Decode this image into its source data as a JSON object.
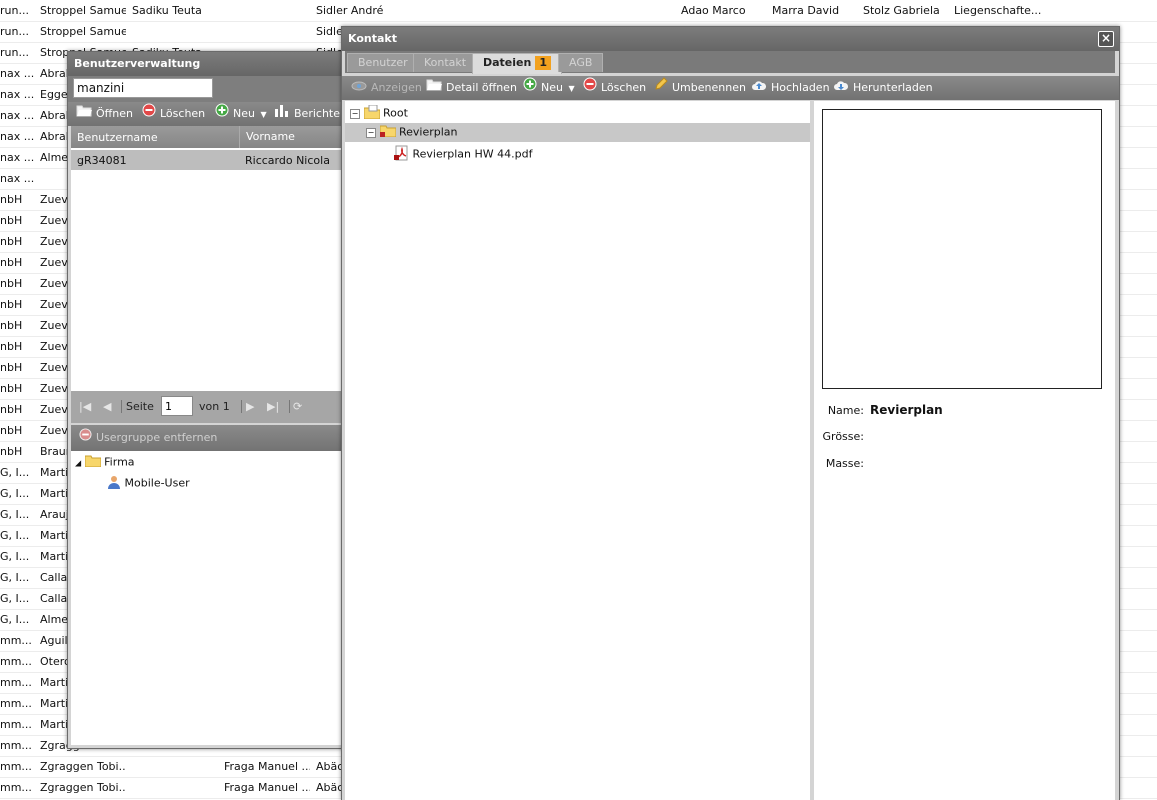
{
  "background_grid": {
    "rows": [
      {
        "c0": "run...",
        "c1": "Stroppel Samuel",
        "c2": "Sadiku Teuta",
        "c3": "",
        "c4": "Sidler André",
        "c5": "Adao Marco",
        "c6": "Marra David",
        "c7": "Stolz Gabriela",
        "c8": "Liegenschafte..."
      },
      {
        "c0": "run...",
        "c1": "Stroppel Samuel",
        "c2": "",
        "c3": "",
        "c4": "Sidle",
        "c5": "",
        "c6": "",
        "c7": "",
        "c8": ""
      },
      {
        "c0": "run...",
        "c1": "Stroppel Samuel",
        "c2": "Sadiku Teuta",
        "c3": "",
        "c4": "Sidle",
        "c5": "",
        "c6": "",
        "c7": "",
        "c8": ""
      },
      {
        "c0": "nax ...",
        "c1": "Abrah",
        "c2": "",
        "c3": "",
        "c4": "",
        "c5": "",
        "c6": "",
        "c7": "",
        "c8": ""
      },
      {
        "c0": "nax ...",
        "c1": "Egger",
        "c2": "",
        "c3": "",
        "c4": "",
        "c5": "",
        "c6": "",
        "c7": "",
        "c8": ""
      },
      {
        "c0": "nax ...",
        "c1": "Abrah",
        "c2": "",
        "c3": "",
        "c4": "",
        "c5": "",
        "c6": "",
        "c7": "",
        "c8": ""
      },
      {
        "c0": "nax ...",
        "c1": "Abrah",
        "c2": "",
        "c3": "",
        "c4": "",
        "c5": "",
        "c6": "",
        "c7": "",
        "c8": ""
      },
      {
        "c0": "nax ...",
        "c1": "Almei",
        "c2": "",
        "c3": "",
        "c4": "",
        "c5": "",
        "c6": "",
        "c7": "",
        "c8": ""
      },
      {
        "c0": "nax ...",
        "c1": "",
        "c2": "",
        "c3": "",
        "c4": "",
        "c5": "",
        "c6": "",
        "c7": "",
        "c8": ""
      },
      {
        "c0": "nbH",
        "c1": "Zuev",
        "c2": "",
        "c3": "",
        "c4": "",
        "c5": "",
        "c6": "",
        "c7": "",
        "c8": ""
      },
      {
        "c0": "nbH",
        "c1": "Zuev",
        "c2": "",
        "c3": "",
        "c4": "",
        "c5": "",
        "c6": "",
        "c7": "",
        "c8": ""
      },
      {
        "c0": "nbH",
        "c1": "Zuev",
        "c2": "",
        "c3": "",
        "c4": "",
        "c5": "",
        "c6": "",
        "c7": "",
        "c8": ""
      },
      {
        "c0": "nbH",
        "c1": "Zuev",
        "c2": "",
        "c3": "",
        "c4": "",
        "c5": "",
        "c6": "",
        "c7": "",
        "c8": ""
      },
      {
        "c0": "nbH",
        "c1": "Zuev",
        "c2": "",
        "c3": "",
        "c4": "",
        "c5": "",
        "c6": "",
        "c7": "",
        "c8": ""
      },
      {
        "c0": "nbH",
        "c1": "Zuev",
        "c2": "",
        "c3": "",
        "c4": "",
        "c5": "",
        "c6": "",
        "c7": "",
        "c8": ""
      },
      {
        "c0": "nbH",
        "c1": "Zuev",
        "c2": "",
        "c3": "",
        "c4": "",
        "c5": "",
        "c6": "",
        "c7": "",
        "c8": ""
      },
      {
        "c0": "nbH",
        "c1": "Zuev",
        "c2": "",
        "c3": "",
        "c4": "",
        "c5": "",
        "c6": "",
        "c7": "",
        "c8": ""
      },
      {
        "c0": "nbH",
        "c1": "Zuev",
        "c2": "",
        "c3": "",
        "c4": "",
        "c5": "",
        "c6": "",
        "c7": "",
        "c8": ""
      },
      {
        "c0": "nbH",
        "c1": "Zuev",
        "c2": "",
        "c3": "",
        "c4": "",
        "c5": "",
        "c6": "",
        "c7": "",
        "c8": ""
      },
      {
        "c0": "nbH",
        "c1": "Zuev",
        "c2": "",
        "c3": "",
        "c4": "",
        "c5": "",
        "c6": "",
        "c7": "",
        "c8": ""
      },
      {
        "c0": "nbH",
        "c1": "Zuev",
        "c2": "",
        "c3": "",
        "c4": "",
        "c5": "",
        "c6": "",
        "c7": "",
        "c8": ""
      },
      {
        "c0": "nbH",
        "c1": "Braun",
        "c2": "",
        "c3": "",
        "c4": "",
        "c5": "",
        "c6": "",
        "c7": "",
        "c8": ""
      },
      {
        "c0": "G, I...",
        "c1": "Marti",
        "c2": "",
        "c3": "",
        "c4": "",
        "c5": "",
        "c6": "",
        "c7": "",
        "c8": ""
      },
      {
        "c0": "G, I...",
        "c1": "Marti",
        "c2": "",
        "c3": "",
        "c4": "",
        "c5": "",
        "c6": "",
        "c7": "",
        "c8": ""
      },
      {
        "c0": "G, I...",
        "c1": "Arauj",
        "c2": "",
        "c3": "",
        "c4": "",
        "c5": "",
        "c6": "",
        "c7": "",
        "c8": ""
      },
      {
        "c0": "G, I...",
        "c1": "Marti",
        "c2": "",
        "c3": "",
        "c4": "",
        "c5": "",
        "c6": "",
        "c7": "",
        "c8": ""
      },
      {
        "c0": "G, I...",
        "c1": "Marti",
        "c2": "",
        "c3": "",
        "c4": "",
        "c5": "",
        "c6": "",
        "c7": "",
        "c8": ""
      },
      {
        "c0": "G, I...",
        "c1": "Callal",
        "c2": "",
        "c3": "",
        "c4": "",
        "c5": "",
        "c6": "",
        "c7": "",
        "c8": ""
      },
      {
        "c0": "G, I...",
        "c1": "Callal",
        "c2": "",
        "c3": "",
        "c4": "",
        "c5": "",
        "c6": "",
        "c7": "",
        "c8": ""
      },
      {
        "c0": "G, I...",
        "c1": "Almei",
        "c2": "",
        "c3": "",
        "c4": "",
        "c5": "",
        "c6": "",
        "c7": "",
        "c8": ""
      },
      {
        "c0": "mm...",
        "c1": "Aguile",
        "c2": "",
        "c3": "",
        "c4": "",
        "c5": "",
        "c6": "",
        "c7": "",
        "c8": ""
      },
      {
        "c0": "mm...",
        "c1": "Otero",
        "c2": "",
        "c3": "",
        "c4": "",
        "c5": "",
        "c6": "",
        "c7": "",
        "c8": ""
      },
      {
        "c0": "mm...",
        "c1": "Marti",
        "c2": "",
        "c3": "",
        "c4": "",
        "c5": "",
        "c6": "",
        "c7": "",
        "c8": ""
      },
      {
        "c0": "mm...",
        "c1": "Marti",
        "c2": "",
        "c3": "",
        "c4": "",
        "c5": "",
        "c6": "",
        "c7": "",
        "c8": ""
      },
      {
        "c0": "mm...",
        "c1": "Marti",
        "c2": "",
        "c3": "",
        "c4": "",
        "c5": "",
        "c6": "",
        "c7": "",
        "c8": ""
      },
      {
        "c0": "mm...",
        "c1": "Zgragg",
        "c2": "",
        "c3": "",
        "c4": "",
        "c5": "",
        "c6": "",
        "c7": "",
        "c8": ""
      },
      {
        "c0": "mm...",
        "c1": "Zgraggen Tobi...",
        "c2": "",
        "c3": "Fraga Manuel ...",
        "c4": "Abäc",
        "c5": "",
        "c6": "",
        "c7": "",
        "c8": ""
      },
      {
        "c0": "mm...",
        "c1": "Zgraggen Tobi...",
        "c2": "",
        "c3": "Fraga Manuel ...",
        "c4": "Abäc",
        "c5": "",
        "c6": "",
        "c7": "",
        "c8": ""
      }
    ]
  },
  "benutzerverwaltung": {
    "title": "Benutzerverwaltung",
    "search_value": "manzini",
    "toolbar": {
      "oeffnen": "Öffnen",
      "loeschen": "Löschen",
      "neu": "Neu",
      "berichte": "Berichte"
    },
    "columns": {
      "benutzername": "Benutzername",
      "vorname": "Vorname"
    },
    "rows": [
      {
        "benutzername": "gR34081",
        "vorname": "Riccardo Nicola"
      }
    ],
    "pager": {
      "seite_label": "Seite",
      "page": "1",
      "von_label": "von 1"
    },
    "usergroup_remove": "Usergruppe entfernen",
    "tree": {
      "root": "Firma",
      "child": "Mobile-User"
    }
  },
  "kontakt": {
    "title": "Kontakt",
    "tabs": [
      {
        "label": "Benutzer"
      },
      {
        "label": "Kontakt"
      },
      {
        "label": "Dateien",
        "badge": "1"
      },
      {
        "label": "AGB"
      }
    ],
    "toolbar": {
      "anzeigen": "Anzeigen",
      "detail_oeffnen": "Detail öffnen",
      "neu": "Neu",
      "loeschen": "Löschen",
      "umbenennen": "Umbenennen",
      "hochladen": "Hochladen",
      "herunterladen": "Herunterladen"
    },
    "file_tree": {
      "root": "Root",
      "folder": "Revierplan",
      "file": "Revierplan HW 44.pdf"
    },
    "details": {
      "name_label": "Name:",
      "name_value": "Revierplan",
      "groesse_label": "Grösse:",
      "masse_label": "Masse:"
    }
  },
  "colors": {
    "titlebar": "#6f6f6f",
    "toolbar": "#7d7d7d",
    "badge": "#f2a11e",
    "selection": "#bdbdbd"
  }
}
